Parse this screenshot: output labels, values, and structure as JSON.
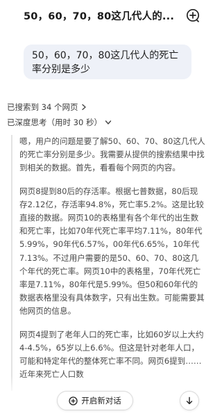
{
  "header": {
    "title": "50，60，70，80这几代人的..."
  },
  "user_message": {
    "text": "50，60，70，80这几代人的死亡率分别是多少"
  },
  "search_status": {
    "label": "已搜索到 34 个网页"
  },
  "thinking_status": {
    "label": "已深度思考（用时 30 秒）"
  },
  "thinking": {
    "paragraphs": [
      "嗯，用户的问题是要了解50、60、70、80这几代人的死亡率分别是多少。我需要从提供的搜索结果中找到相关的数据。首先，看看每个网页的内容。",
      "网页8提到80后的存活率。根据七普数据，80后现存2.12亿，存活率94.8%，死亡率5.2%。这是比较直接的数据。网页10的表格里有各个年代的出生数和死亡率，比如70年代死亡率平均7.11%，80年代5.99%，90年代6.57%，00年代6.65%，10年代7.13%。不过用户需要的是50、60、70、80这几个年代的死亡率。网页10中的表格里，70年代死亡率是7.11%，80年代是5.99%。但50和60年代的数据表格里没有具体数字，只有出生数。可能需要其他网页的信息。",
      "网页4提到了老年人口的死亡率，比如60岁以上大约4-4.5%，65岁以上6.6%。但这是针对老年人口，可能和特定年代的整体死亡率不同。网页6提到……近年来死亡人口数"
    ]
  },
  "bottom": {
    "new_chat_label": "开启新对话"
  }
}
